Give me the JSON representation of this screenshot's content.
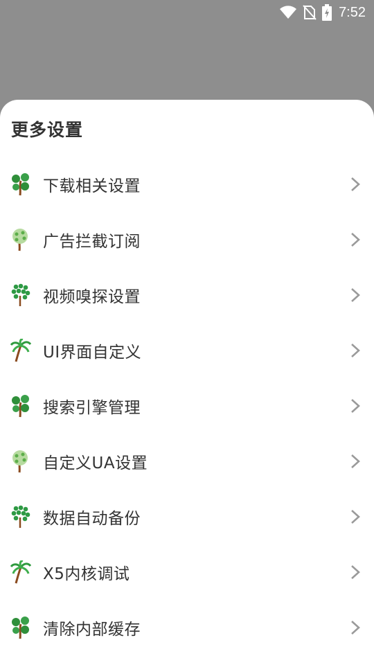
{
  "status_bar": {
    "time": "7:52",
    "icons": [
      "wifi-icon",
      "no-sim-icon",
      "battery-charging-icon"
    ]
  },
  "sheet": {
    "title": "更多设置"
  },
  "menu": {
    "items": [
      {
        "label": "下载相关设置",
        "icon": "tree-round-icon"
      },
      {
        "label": "广告拦截订阅",
        "icon": "tree-light-icon"
      },
      {
        "label": "视频嗅探设置",
        "icon": "tree-dots-icon"
      },
      {
        "label": "UI界面自定义",
        "icon": "palm-tree-icon"
      },
      {
        "label": "搜索引擎管理",
        "icon": "tree-round-icon"
      },
      {
        "label": "自定义UA设置",
        "icon": "tree-light-icon"
      },
      {
        "label": "数据自动备份",
        "icon": "tree-dots-icon"
      },
      {
        "label": "X5内核调试",
        "icon": "palm-tree-icon"
      },
      {
        "label": "清除内部缓存",
        "icon": "tree-round-icon"
      }
    ]
  },
  "colors": {
    "scrim": "#8e8e8e",
    "sheet_bg": "#ffffff",
    "text": "#333333",
    "chevron": "#9a9a9a"
  }
}
